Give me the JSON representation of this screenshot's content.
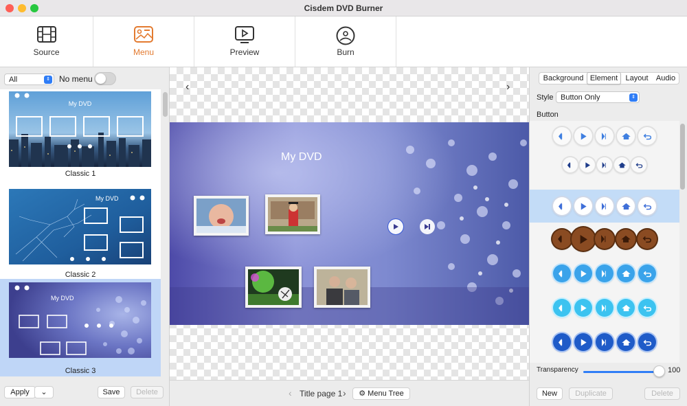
{
  "window": {
    "title": "Cisdem DVD Burner"
  },
  "toolbar": {
    "tabs": [
      {
        "label": "Source",
        "icon": "film-icon"
      },
      {
        "label": "Menu",
        "icon": "menu-image-icon",
        "active": true
      },
      {
        "label": "Preview",
        "icon": "play-screen-icon"
      },
      {
        "label": "Burn",
        "icon": "disc-icon"
      }
    ],
    "active_color": "#e37a2f"
  },
  "left_panel": {
    "filter_value": "All",
    "no_menu_label": "No menu",
    "no_menu_on": false,
    "templates": [
      {
        "name": "Classic 1",
        "thumb_title": "My DVD"
      },
      {
        "name": "Classic 2",
        "thumb_title": "My DVD"
      },
      {
        "name": "Classic 3",
        "thumb_title": "My DVD",
        "selected": true
      }
    ],
    "apply_label": "Apply",
    "save_label": "Save",
    "delete_label": "Delete"
  },
  "canvas": {
    "menu_title": "My DVD",
    "page_label": "Title page 1",
    "menu_tree_label": "Menu Tree"
  },
  "right_panel": {
    "tabs": [
      "Background",
      "Element",
      "Layout",
      "Audio"
    ],
    "active_tab": "Element",
    "style_label": "Style",
    "style_value": "Button Only",
    "button_section_label": "Button",
    "transparency_label": "Transparency",
    "transparency_value": "100",
    "new_label": "New",
    "duplicate_label": "Duplicate",
    "delete_label": "Delete"
  },
  "colors": {
    "accent": "#2f7df6",
    "selection": "#bfd6f7"
  }
}
